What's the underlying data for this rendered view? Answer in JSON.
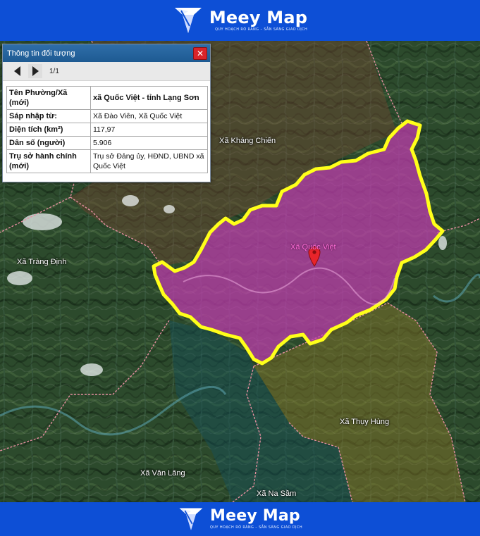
{
  "brand": {
    "name": "Meey Map",
    "tagline": "QUY HOẠCH RÕ RÀNG – SẴN SÀNG GIAO DỊCH",
    "colors": {
      "bar": "#0d4fd6"
    }
  },
  "popup": {
    "title": "Thông tin đối tượng",
    "close_icon": "✕",
    "pager": "1/1",
    "rows": [
      {
        "key": "Tên Phường/Xã (mới)",
        "value": "xã Quốc Việt - tỉnh Lạng Sơn"
      },
      {
        "key": "Sáp nhập từ:",
        "value": "Xã Đào Viên, Xã Quốc Việt"
      },
      {
        "key": "Diện tích (km²)",
        "value": "117,97"
      },
      {
        "key": "Dân số (người)",
        "value": "5.906"
      },
      {
        "key": "Trụ sở hành chính (mới)",
        "value": "Trụ sở Đảng ủy, HĐND, UBND xã Quốc Việt"
      }
    ]
  },
  "map": {
    "labels": {
      "khang_chien": "Xã Kháng Chiến",
      "quoc_viet": "Xã Quốc Việt",
      "trang_dinh": "Xã Tràng Định",
      "thuy_hung": "Xã Thụy Hùng",
      "van_lang": "Xã Vân Lăng",
      "na_sam": "Xã Na Sầm"
    },
    "colors": {
      "highlight_fill": "#c23bb0",
      "highlight_border": "#ffff1a",
      "marker": "#e8242a"
    }
  }
}
